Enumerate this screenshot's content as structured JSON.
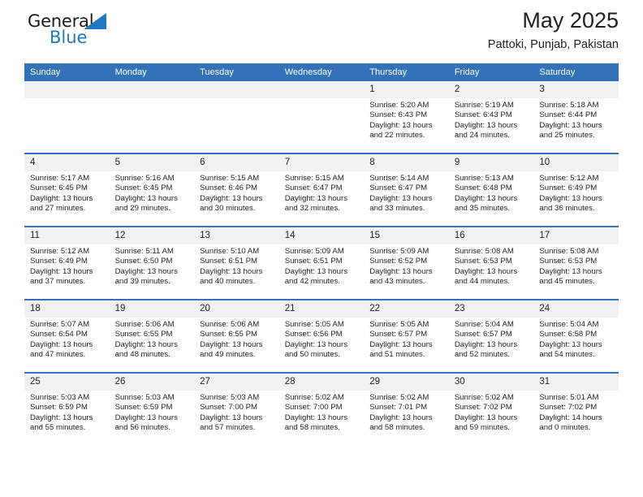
{
  "brand": {
    "name_top": "General",
    "name_bottom": "Blue",
    "triangle_color": "#1f78c1"
  },
  "header": {
    "title": "May 2025",
    "subtitle": "Pattoki, Punjab, Pakistan"
  },
  "colors": {
    "header_blue": "#3372b8",
    "daynum_gray": "#f1f1f1",
    "text": "#231f20",
    "brand_blue": "#1f78c1"
  },
  "weekday_headers": [
    "Sunday",
    "Monday",
    "Tuesday",
    "Wednesday",
    "Thursday",
    "Friday",
    "Saturday"
  ],
  "labels": {
    "sunrise_prefix": "Sunrise:",
    "sunset_prefix": "Sunset:",
    "daylight_prefix": "Daylight:"
  },
  "weeks": [
    [
      {
        "day": "",
        "empty": true
      },
      {
        "day": "",
        "empty": true
      },
      {
        "day": "",
        "empty": true
      },
      {
        "day": "",
        "empty": true
      },
      {
        "day": "1",
        "sunrise": "Sunrise: 5:20 AM",
        "sunset": "Sunset: 6:43 PM",
        "daylight": "Daylight: 13 hours and 22 minutes."
      },
      {
        "day": "2",
        "sunrise": "Sunrise: 5:19 AM",
        "sunset": "Sunset: 6:43 PM",
        "daylight": "Daylight: 13 hours and 24 minutes."
      },
      {
        "day": "3",
        "sunrise": "Sunrise: 5:18 AM",
        "sunset": "Sunset: 6:44 PM",
        "daylight": "Daylight: 13 hours and 25 minutes."
      }
    ],
    [
      {
        "day": "4",
        "sunrise": "Sunrise: 5:17 AM",
        "sunset": "Sunset: 6:45 PM",
        "daylight": "Daylight: 13 hours and 27 minutes."
      },
      {
        "day": "5",
        "sunrise": "Sunrise: 5:16 AM",
        "sunset": "Sunset: 6:45 PM",
        "daylight": "Daylight: 13 hours and 29 minutes."
      },
      {
        "day": "6",
        "sunrise": "Sunrise: 5:15 AM",
        "sunset": "Sunset: 6:46 PM",
        "daylight": "Daylight: 13 hours and 30 minutes."
      },
      {
        "day": "7",
        "sunrise": "Sunrise: 5:15 AM",
        "sunset": "Sunset: 6:47 PM",
        "daylight": "Daylight: 13 hours and 32 minutes."
      },
      {
        "day": "8",
        "sunrise": "Sunrise: 5:14 AM",
        "sunset": "Sunset: 6:47 PM",
        "daylight": "Daylight: 13 hours and 33 minutes."
      },
      {
        "day": "9",
        "sunrise": "Sunrise: 5:13 AM",
        "sunset": "Sunset: 6:48 PM",
        "daylight": "Daylight: 13 hours and 35 minutes."
      },
      {
        "day": "10",
        "sunrise": "Sunrise: 5:12 AM",
        "sunset": "Sunset: 6:49 PM",
        "daylight": "Daylight: 13 hours and 36 minutes."
      }
    ],
    [
      {
        "day": "11",
        "sunrise": "Sunrise: 5:12 AM",
        "sunset": "Sunset: 6:49 PM",
        "daylight": "Daylight: 13 hours and 37 minutes."
      },
      {
        "day": "12",
        "sunrise": "Sunrise: 5:11 AM",
        "sunset": "Sunset: 6:50 PM",
        "daylight": "Daylight: 13 hours and 39 minutes."
      },
      {
        "day": "13",
        "sunrise": "Sunrise: 5:10 AM",
        "sunset": "Sunset: 6:51 PM",
        "daylight": "Daylight: 13 hours and 40 minutes."
      },
      {
        "day": "14",
        "sunrise": "Sunrise: 5:09 AM",
        "sunset": "Sunset: 6:51 PM",
        "daylight": "Daylight: 13 hours and 42 minutes."
      },
      {
        "day": "15",
        "sunrise": "Sunrise: 5:09 AM",
        "sunset": "Sunset: 6:52 PM",
        "daylight": "Daylight: 13 hours and 43 minutes."
      },
      {
        "day": "16",
        "sunrise": "Sunrise: 5:08 AM",
        "sunset": "Sunset: 6:53 PM",
        "daylight": "Daylight: 13 hours and 44 minutes."
      },
      {
        "day": "17",
        "sunrise": "Sunrise: 5:08 AM",
        "sunset": "Sunset: 6:53 PM",
        "daylight": "Daylight: 13 hours and 45 minutes."
      }
    ],
    [
      {
        "day": "18",
        "sunrise": "Sunrise: 5:07 AM",
        "sunset": "Sunset: 6:54 PM",
        "daylight": "Daylight: 13 hours and 47 minutes."
      },
      {
        "day": "19",
        "sunrise": "Sunrise: 5:06 AM",
        "sunset": "Sunset: 6:55 PM",
        "daylight": "Daylight: 13 hours and 48 minutes."
      },
      {
        "day": "20",
        "sunrise": "Sunrise: 5:06 AM",
        "sunset": "Sunset: 6:55 PM",
        "daylight": "Daylight: 13 hours and 49 minutes."
      },
      {
        "day": "21",
        "sunrise": "Sunrise: 5:05 AM",
        "sunset": "Sunset: 6:56 PM",
        "daylight": "Daylight: 13 hours and 50 minutes."
      },
      {
        "day": "22",
        "sunrise": "Sunrise: 5:05 AM",
        "sunset": "Sunset: 6:57 PM",
        "daylight": "Daylight: 13 hours and 51 minutes."
      },
      {
        "day": "23",
        "sunrise": "Sunrise: 5:04 AM",
        "sunset": "Sunset: 6:57 PM",
        "daylight": "Daylight: 13 hours and 52 minutes."
      },
      {
        "day": "24",
        "sunrise": "Sunrise: 5:04 AM",
        "sunset": "Sunset: 6:58 PM",
        "daylight": "Daylight: 13 hours and 54 minutes."
      }
    ],
    [
      {
        "day": "25",
        "sunrise": "Sunrise: 5:03 AM",
        "sunset": "Sunset: 6:59 PM",
        "daylight": "Daylight: 13 hours and 55 minutes."
      },
      {
        "day": "26",
        "sunrise": "Sunrise: 5:03 AM",
        "sunset": "Sunset: 6:59 PM",
        "daylight": "Daylight: 13 hours and 56 minutes."
      },
      {
        "day": "27",
        "sunrise": "Sunrise: 5:03 AM",
        "sunset": "Sunset: 7:00 PM",
        "daylight": "Daylight: 13 hours and 57 minutes."
      },
      {
        "day": "28",
        "sunrise": "Sunrise: 5:02 AM",
        "sunset": "Sunset: 7:00 PM",
        "daylight": "Daylight: 13 hours and 58 minutes."
      },
      {
        "day": "29",
        "sunrise": "Sunrise: 5:02 AM",
        "sunset": "Sunset: 7:01 PM",
        "daylight": "Daylight: 13 hours and 58 minutes."
      },
      {
        "day": "30",
        "sunrise": "Sunrise: 5:02 AM",
        "sunset": "Sunset: 7:02 PM",
        "daylight": "Daylight: 13 hours and 59 minutes."
      },
      {
        "day": "31",
        "sunrise": "Sunrise: 5:01 AM",
        "sunset": "Sunset: 7:02 PM",
        "daylight": "Daylight: 14 hours and 0 minutes."
      }
    ]
  ]
}
